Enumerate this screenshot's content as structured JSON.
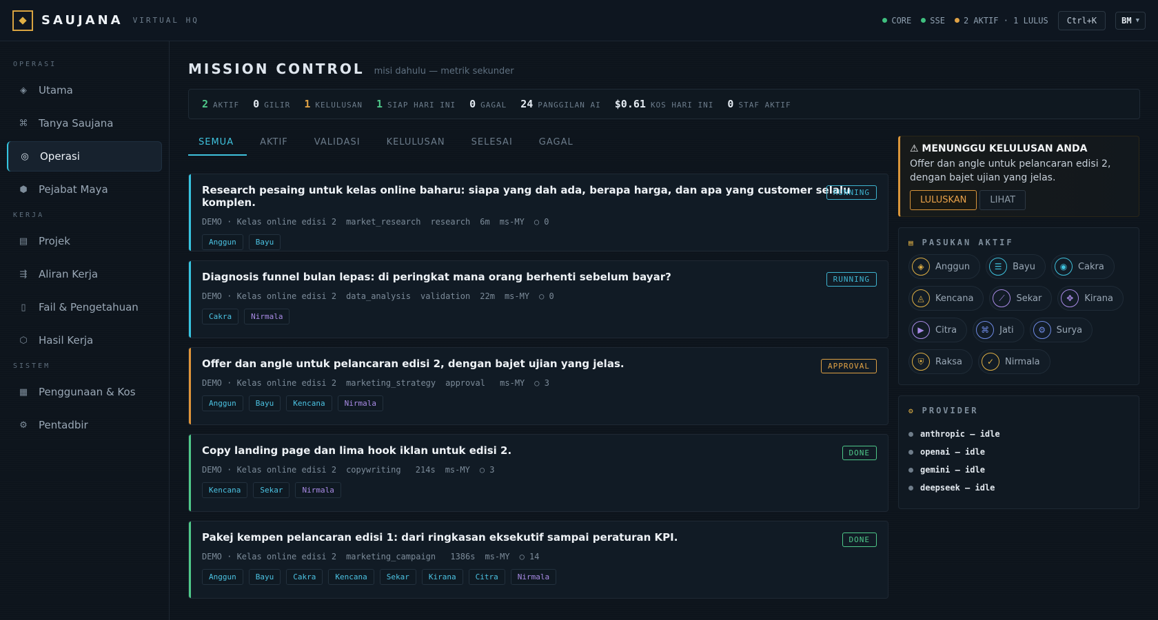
{
  "header": {
    "brand": "SAUJANA",
    "brand_sub": "VIRTUAL HQ",
    "status": [
      {
        "label": "CORE",
        "color": "#3fbf7f"
      },
      {
        "label": "SSE",
        "color": "#3fbf7f"
      },
      {
        "label": "2 AKTIF · 1 LULUS",
        "color": "#e0a245"
      }
    ],
    "shortcut": "Ctrl+K",
    "language": "BM"
  },
  "sidebar": {
    "sections": [
      {
        "title": "OPERASI",
        "items": [
          {
            "label": "Utama",
            "icon": "◈",
            "active": false
          },
          {
            "label": "Tanya Saujana",
            "icon": "⌘",
            "active": false
          },
          {
            "label": "Operasi",
            "icon": "◎",
            "active": true
          },
          {
            "label": "Pejabat Maya",
            "icon": "⬢",
            "active": false
          }
        ]
      },
      {
        "title": "KERJA",
        "items": [
          {
            "label": "Projek",
            "icon": "▤",
            "active": false
          },
          {
            "label": "Aliran Kerja",
            "icon": "⇶",
            "active": false
          },
          {
            "label": "Fail & Pengetahuan",
            "icon": "▯",
            "active": false
          },
          {
            "label": "Hasil Kerja",
            "icon": "⬡",
            "active": false
          }
        ]
      },
      {
        "title": "SISTEM",
        "items": [
          {
            "label": "Penggunaan & Kos",
            "icon": "▦",
            "active": false
          },
          {
            "label": "Pentadbir",
            "icon": "⚙",
            "active": false
          }
        ]
      }
    ]
  },
  "main": {
    "title": "MISSION CONTROL",
    "subtitle": "misi dahulu — metrik sekunder",
    "stats": [
      {
        "value": "2",
        "label": "AKTIF",
        "color": "#4fc98a"
      },
      {
        "value": "0",
        "label": "GILIR",
        "color": "#e4ebf2"
      },
      {
        "value": "1",
        "label": "KELULUSAN",
        "color": "#e0a245"
      },
      {
        "value": "1",
        "label": "SIAP HARI INI",
        "color": "#4fc98a"
      },
      {
        "value": "0",
        "label": "GAGAL",
        "color": "#e4ebf2"
      },
      {
        "value": "24",
        "label": "PANGGILAN AI",
        "color": "#e4ebf2"
      },
      {
        "value": "$0.61",
        "label": "KOS HARI INI",
        "color": "#e4ebf2"
      },
      {
        "value": "0",
        "label": "STAF AKTIF",
        "color": "#e4ebf2"
      }
    ],
    "tabs": [
      "SEMUA",
      "AKTIF",
      "VALIDASI",
      "KELULUSAN",
      "SELESAI",
      "GAGAL"
    ],
    "active_tab": 0,
    "missions": [
      {
        "title": "Research pesaing untuk kelas online baharu: siapa yang dah ada, berapa harga, dan apa yang customer selalu komplen.",
        "meta": [
          "DEMO · Kelas online edisi 2",
          "market_research",
          "research",
          "6m",
          "ms-MY",
          "○ 0"
        ],
        "tags": [
          "Anggun",
          "Bayu"
        ],
        "status": "RUNNING",
        "status_color": "#3fb6d2",
        "bar_color": "#37c4e0"
      },
      {
        "title": "Diagnosis funnel bulan lepas: di peringkat mana orang berhenti sebelum bayar?",
        "meta": [
          "DEMO · Kelas online edisi 2",
          "data_analysis",
          "validation",
          "22m",
          "ms-MY",
          "○ 0"
        ],
        "tags": [
          "Cakra",
          "Nirmala"
        ],
        "status": "RUNNING",
        "status_color": "#3fb6d2",
        "bar_color": "#37c4e0"
      },
      {
        "title": "Offer dan angle untuk pelancaran edisi 2, dengan bajet ujian yang jelas.",
        "meta": [
          "DEMO · Kelas online edisi 2",
          "marketing_strategy",
          "approval",
          " ms-MY",
          "○ 3"
        ],
        "tags": [
          "Anggun",
          "Bayu",
          "Kencana",
          "Nirmala"
        ],
        "status": "APPROVAL",
        "status_color": "#e0a245",
        "bar_color": "#e0953a"
      },
      {
        "title": "Copy landing page dan lima hook iklan untuk edisi 2.",
        "meta": [
          "DEMO · Kelas online edisi 2",
          "copywriting",
          " 214s",
          "ms-MY",
          "○ 3"
        ],
        "tags": [
          "Kencana",
          "Sekar",
          "Nirmala"
        ],
        "status": "DONE",
        "status_color": "#4fc98a",
        "bar_color": "#4fc98a"
      },
      {
        "title": "Pakej kempen pelancaran edisi 1: dari ringkasan eksekutif sampai peraturan KPI.",
        "meta": [
          "DEMO · Kelas online edisi 2",
          "marketing_campaign",
          " 1386s",
          "ms-MY",
          "○ 14"
        ],
        "tags": [
          "Anggun",
          "Bayu",
          "Cakra",
          "Kencana",
          "Sekar",
          "Kirana",
          "Citra",
          "Nirmala"
        ],
        "status": "DONE",
        "status_color": "#4fc98a",
        "bar_color": "#4fc98a"
      }
    ]
  },
  "tag_colors": {
    "Anggun": "#4cc3e3",
    "Bayu": "#4cc3e3",
    "Cakra": "#4cc3e3",
    "Kencana": "#4cc3e3",
    "Sekar": "#4cc3e3",
    "Kirana": "#4cc3e3",
    "Citra": "#4cc3e3",
    "Nirmala": "#a98be6"
  },
  "approval": {
    "heading": "⚠ MENUNGGU KELULUSAN ANDA",
    "text": "Offer dan angle untuk pelancaran edisi 2, dengan bajet ujian yang jelas.",
    "approve_label": "LULUSKAN",
    "view_label": "LIHAT"
  },
  "squad": {
    "title": "PASUKAN AKTIF",
    "agents": [
      {
        "name": "Anggun",
        "icon": "◈",
        "color": "#e0b044"
      },
      {
        "name": "Bayu",
        "icon": "☰",
        "color": "#3fc3de"
      },
      {
        "name": "Cakra",
        "icon": "◉",
        "color": "#3fc3de"
      },
      {
        "name": "Kencana",
        "icon": "◬",
        "color": "#e0b044"
      },
      {
        "name": "Sekar",
        "icon": "⟋",
        "color": "#a98be6"
      },
      {
        "name": "Kirana",
        "icon": "✥",
        "color": "#a98be6"
      },
      {
        "name": "Citra",
        "icon": "▶",
        "color": "#a98be6"
      },
      {
        "name": "Jati",
        "icon": "⌘",
        "color": "#6f8be6"
      },
      {
        "name": "Surya",
        "icon": "⚙",
        "color": "#6f8be6"
      },
      {
        "name": "Raksa",
        "icon": "⛨",
        "color": "#e0b044"
      },
      {
        "name": "Nirmala",
        "icon": "✓",
        "color": "#e0b044"
      }
    ]
  },
  "provider": {
    "title": "PROVIDER",
    "items": [
      "anthropic — idle",
      "openai — idle",
      "gemini — idle",
      "deepseek — idle"
    ]
  }
}
